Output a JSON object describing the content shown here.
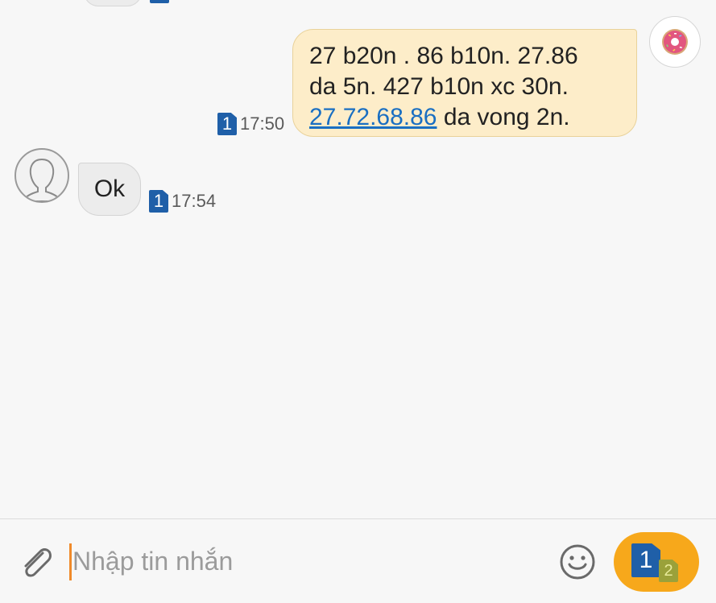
{
  "conversation": {
    "outgoing_message": {
      "lines": [
        "27 b20n  . 86 b10n. 27.86",
        "da 5n. 427 b10n xc 30n."
      ],
      "link_text": "27.72.68.86",
      "link_suffix": " da vong 2n.",
      "sim": "1",
      "time": "17:50"
    },
    "incoming_message": {
      "text": "Ok",
      "sim": "1",
      "time": "17:54"
    }
  },
  "composer": {
    "placeholder": "Nhập tin nhắn",
    "value": "",
    "send_primary_sim": "1",
    "send_secondary_sim": "2",
    "accent_color": "#f7a81b"
  },
  "icons": {
    "attach": "paperclip-icon",
    "emoji": "smiley-icon",
    "my_avatar": "donut-avatar-icon",
    "contact_avatar": "person-silhouette-icon"
  },
  "colors": {
    "outgoing_bubble": "#fdedc9",
    "incoming_bubble": "#ececec",
    "sim_badge": "#1f5fa8",
    "link": "#1a6fc2"
  }
}
